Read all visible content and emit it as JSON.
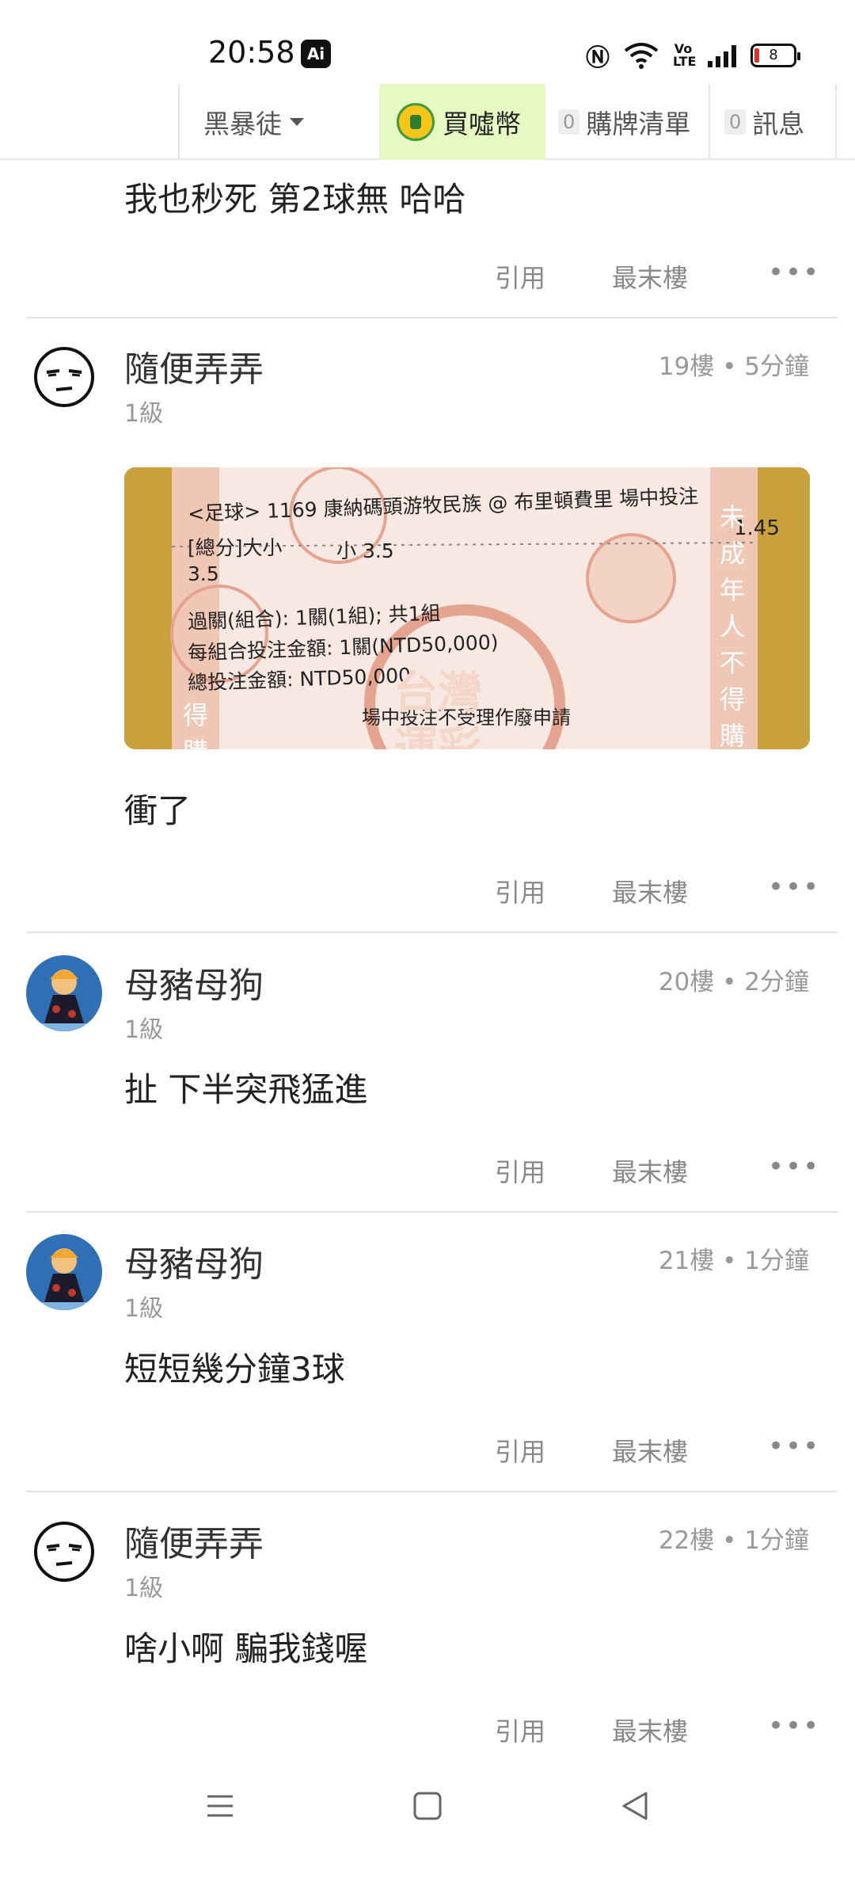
{
  "status": {
    "time": "20:58",
    "ai_badge": "Ai",
    "battery": "8",
    "volte": "Vo LTE"
  },
  "nav": {
    "user": "黑暴徒",
    "coin": "買噓幣",
    "list_count": "0",
    "list_label": "購牌清單",
    "msg_count": "0",
    "msg_label": "訊息"
  },
  "actions": {
    "quote": "引用",
    "last_floor": "最末樓",
    "more": "•••"
  },
  "posts": [
    {
      "text": "我也秒死 第2球無 哈哈"
    },
    {
      "author": "隨便弄弄",
      "level": "1級",
      "floor": "19樓 • 5分鐘",
      "ticket": {
        "l1": "<足球> 1169  康納碼頭游牧民族 @ 布里頓費里 場中投注",
        "l2a": "[總分]大小",
        "l2b": "小 3.5",
        "odds": "1.45",
        "l3": "3.5",
        "l4": "過關(組合): 1關(1組); 共1組",
        "l5": "每組合投注金額: 1關(NTD50,000)",
        "l6": "總投注金額: NTD50,000",
        "l7": "場中投注不受理作廢申請",
        "stamp1": "台灣",
        "stamp2": "運彩",
        "side": "未成年人不得購",
        "left_side": "得購"
      },
      "text": "衝了"
    },
    {
      "author": "母豬母狗",
      "level": "1級",
      "floor": "20樓 • 2分鐘",
      "text": "扯 下半突飛猛進"
    },
    {
      "author": "母豬母狗",
      "level": "1級",
      "floor": "21樓 • 1分鐘",
      "text": "短短幾分鐘3球"
    },
    {
      "author": "隨便弄弄",
      "level": "1級",
      "floor": "22樓 • 1分鐘",
      "text": "啥小啊 騙我錢喔"
    }
  ]
}
